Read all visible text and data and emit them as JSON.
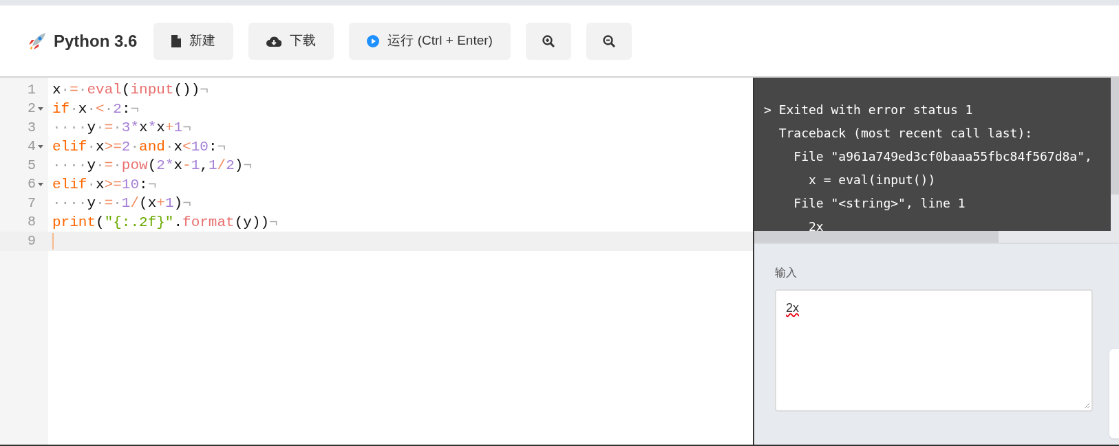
{
  "toolbar": {
    "title": "Python 3.6",
    "buttons": [
      {
        "kind": "new",
        "label": "新建"
      },
      {
        "kind": "download",
        "label": "下载"
      },
      {
        "kind": "run",
        "label": "运行 (Ctrl + Enter)"
      },
      {
        "kind": "zoom_in"
      },
      {
        "kind": "zoom_out"
      }
    ]
  },
  "editor": {
    "lines": [
      {
        "number": "1",
        "fold": false,
        "active": false,
        "tokens": [
          {
            "kind": "plain",
            "text": "x"
          },
          {
            "kind": "ws",
            "text": "·"
          },
          {
            "kind": "op",
            "text": "="
          },
          {
            "kind": "ws",
            "text": "·"
          },
          {
            "kind": "fn",
            "text": "eval"
          },
          {
            "kind": "plain",
            "text": "("
          },
          {
            "kind": "fn",
            "text": "input"
          },
          {
            "kind": "plain",
            "text": "())"
          },
          {
            "kind": "ws",
            "text": "¬"
          }
        ]
      },
      {
        "number": "2",
        "fold": true,
        "active": false,
        "tokens": [
          {
            "kind": "kw",
            "text": "if"
          },
          {
            "kind": "ws",
            "text": "·"
          },
          {
            "kind": "plain",
            "text": "x"
          },
          {
            "kind": "ws",
            "text": "·"
          },
          {
            "kind": "op",
            "text": "<"
          },
          {
            "kind": "ws",
            "text": "·"
          },
          {
            "kind": "num",
            "text": "2"
          },
          {
            "kind": "plain",
            "text": ":"
          },
          {
            "kind": "ws",
            "text": "¬"
          }
        ]
      },
      {
        "number": "3",
        "fold": false,
        "active": false,
        "tokens": [
          {
            "kind": "ws",
            "text": "····"
          },
          {
            "kind": "plain",
            "text": "y"
          },
          {
            "kind": "ws",
            "text": "·"
          },
          {
            "kind": "op",
            "text": "="
          },
          {
            "kind": "ws",
            "text": "·"
          },
          {
            "kind": "num",
            "text": "3"
          },
          {
            "kind": "mul",
            "text": "*"
          },
          {
            "kind": "plain",
            "text": "x"
          },
          {
            "kind": "mul",
            "text": "*"
          },
          {
            "kind": "plain",
            "text": "x"
          },
          {
            "kind": "op",
            "text": "+"
          },
          {
            "kind": "num",
            "text": "1"
          },
          {
            "kind": "ws",
            "text": "¬"
          }
        ]
      },
      {
        "number": "4",
        "fold": true,
        "active": false,
        "tokens": [
          {
            "kind": "kw",
            "text": "elif"
          },
          {
            "kind": "ws",
            "text": "·"
          },
          {
            "kind": "plain",
            "text": "x"
          },
          {
            "kind": "op",
            "text": ">="
          },
          {
            "kind": "num",
            "text": "2"
          },
          {
            "kind": "ws",
            "text": "·"
          },
          {
            "kind": "kw",
            "text": "and"
          },
          {
            "kind": "ws",
            "text": "·"
          },
          {
            "kind": "plain",
            "text": "x"
          },
          {
            "kind": "op",
            "text": "<"
          },
          {
            "kind": "num",
            "text": "10"
          },
          {
            "kind": "plain",
            "text": ":"
          },
          {
            "kind": "ws",
            "text": "¬"
          }
        ]
      },
      {
        "number": "5",
        "fold": false,
        "active": false,
        "tokens": [
          {
            "kind": "ws",
            "text": "····"
          },
          {
            "kind": "plain",
            "text": "y"
          },
          {
            "kind": "ws",
            "text": "·"
          },
          {
            "kind": "op",
            "text": "="
          },
          {
            "kind": "ws",
            "text": "·"
          },
          {
            "kind": "fn",
            "text": "pow"
          },
          {
            "kind": "plain",
            "text": "("
          },
          {
            "kind": "num",
            "text": "2"
          },
          {
            "kind": "mul",
            "text": "*"
          },
          {
            "kind": "plain",
            "text": "x"
          },
          {
            "kind": "op",
            "text": "-"
          },
          {
            "kind": "num",
            "text": "1"
          },
          {
            "kind": "plain",
            "text": ","
          },
          {
            "kind": "num",
            "text": "1"
          },
          {
            "kind": "op",
            "text": "/"
          },
          {
            "kind": "num",
            "text": "2"
          },
          {
            "kind": "plain",
            "text": ")"
          },
          {
            "kind": "ws",
            "text": "¬"
          }
        ]
      },
      {
        "number": "6",
        "fold": true,
        "active": false,
        "tokens": [
          {
            "kind": "kw",
            "text": "elif"
          },
          {
            "kind": "ws",
            "text": "·"
          },
          {
            "kind": "plain",
            "text": "x"
          },
          {
            "kind": "op",
            "text": ">="
          },
          {
            "kind": "num",
            "text": "10"
          },
          {
            "kind": "plain",
            "text": ":"
          },
          {
            "kind": "ws",
            "text": "¬"
          }
        ]
      },
      {
        "number": "7",
        "fold": false,
        "active": false,
        "tokens": [
          {
            "kind": "ws",
            "text": "····"
          },
          {
            "kind": "plain",
            "text": "y"
          },
          {
            "kind": "ws",
            "text": "·"
          },
          {
            "kind": "op",
            "text": "="
          },
          {
            "kind": "ws",
            "text": "·"
          },
          {
            "kind": "num",
            "text": "1"
          },
          {
            "kind": "op",
            "text": "/"
          },
          {
            "kind": "plain",
            "text": "(x"
          },
          {
            "kind": "op",
            "text": "+"
          },
          {
            "kind": "num",
            "text": "1"
          },
          {
            "kind": "plain",
            "text": ")"
          },
          {
            "kind": "ws",
            "text": "¬"
          }
        ]
      },
      {
        "number": "8",
        "fold": false,
        "active": false,
        "tokens": [
          {
            "kind": "kw",
            "text": "print"
          },
          {
            "kind": "plain",
            "text": "("
          },
          {
            "kind": "str",
            "text": "\"{:.2f}\""
          },
          {
            "kind": "plain",
            "text": "."
          },
          {
            "kind": "fn",
            "text": "format"
          },
          {
            "kind": "plain",
            "text": "(y))"
          },
          {
            "kind": "ws",
            "text": "¬"
          }
        ]
      },
      {
        "number": "9",
        "fold": false,
        "active": true
      }
    ]
  },
  "output": {
    "lines": [
      "> Exited with error status 1",
      "  Traceback (most recent call last):",
      "    File \"a961a749ed3cf0baaa55fbc84f567d8a\",",
      "      x = eval(input())",
      "    File \"<string>\", line 1",
      "      2x"
    ]
  },
  "input": {
    "label": "输入",
    "value": "2x"
  }
}
